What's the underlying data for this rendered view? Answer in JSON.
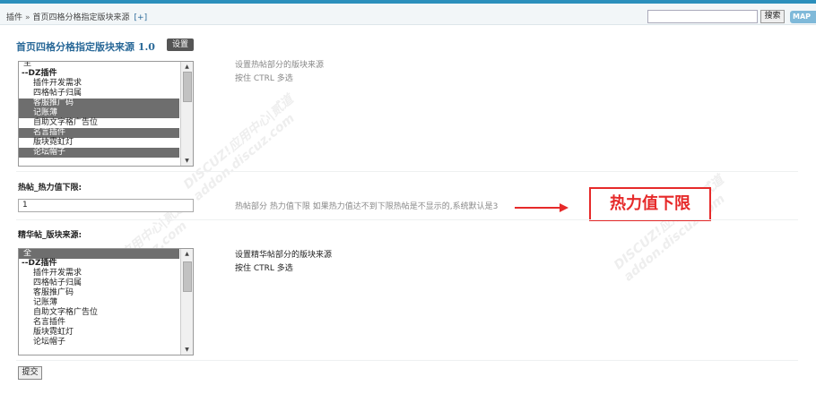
{
  "header": {
    "breadcrumb_root": "插件",
    "breadcrumb_sep": "»",
    "breadcrumb_current": "首页四格分格指定版块来源",
    "breadcrumb_add": "[+]",
    "search_button": "搜索",
    "map_button": "MAP"
  },
  "plugin": {
    "title": "首页四格分格指定版块来源 1.0",
    "settings_button": "设置"
  },
  "section1": {
    "options": [
      "主",
      "--DZ插件",
      "插件开发需求",
      "四格帖子归属",
      "客服推广码",
      "记账薄",
      "自助文字格广告位",
      "名言插件",
      "版块霓虹灯",
      "论坛帽子"
    ],
    "selected": [
      4,
      5,
      7,
      9
    ],
    "desc_line1": "设置热帖部分的版块来源",
    "desc_line2": "按住 CTRL 多选"
  },
  "section2": {
    "label": "热帖_热力值下限:",
    "value": "1",
    "desc": "热帖部分 热力值下限 如果热力值达不到下限热帖是不显示的,系统默认是3"
  },
  "annotation": {
    "text": "热力值下限",
    "color": "#e62a2a"
  },
  "section3": {
    "label": "精华帖_版块来源:",
    "options": [
      "全",
      "--DZ插件",
      "插件开发需求",
      "四格帖子归属",
      "客服推广码",
      "记账薄",
      "自助文字格广告位",
      "名言插件",
      "版块霓虹灯",
      "论坛帽子"
    ],
    "selected": [
      0
    ],
    "desc_line1": "设置精华帖部分的版块来源",
    "desc_line2": "按住 CTRL 多选"
  },
  "footer": {
    "submit_button": "提交"
  },
  "watermark": {
    "text1": "DISCUZ!应用中心|贰道",
    "text2": "addon.discuz.com"
  },
  "colors": {
    "accent": "#2b6a99",
    "topline": "#2b8fbc",
    "selected_option": "#6e6e6e"
  }
}
